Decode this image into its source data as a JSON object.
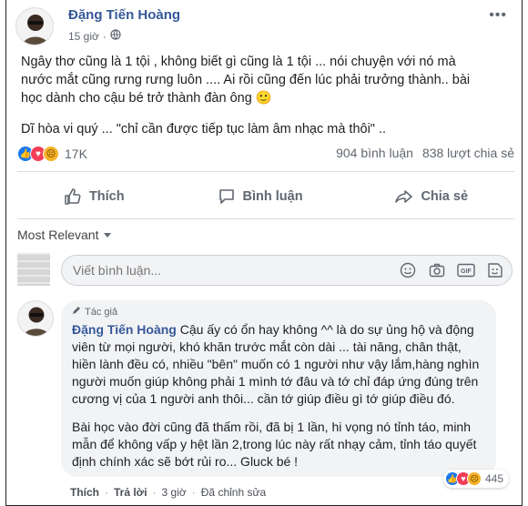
{
  "post": {
    "author": "Đặng Tiến Hoàng",
    "time": "15 giờ",
    "more": "•••",
    "paragraph1": "Ngây thơ cũng là 1 tội , không biết gì cũng là 1 tội ... nói chuyện với nó mà nước mắt cũng rưng rưng luôn .... Ai rồi cũng đến lúc phải trưởng thành.. bài học dành cho cậu bé trở thành đàn ông 🙂",
    "paragraph2": "Dĩ hòa vi quý ... \"chỉ cần được tiếp tục làm âm nhạc mà thôi\" .."
  },
  "stats": {
    "reaction_count": "17K",
    "comments": "904 bình luận",
    "shares": "838 lượt chia sẻ"
  },
  "actions": {
    "like": "Thích",
    "comment": "Bình luận",
    "share": "Chia sẻ"
  },
  "comments_section": {
    "sort_label": "Most Relevant",
    "input_placeholder": "Viết bình luận..."
  },
  "reply": {
    "badge": "Tác giả",
    "author": "Đặng Tiến Hoàng",
    "text1": "Cậu ấy có ổn hay không ^^ là do sự ủng hộ và động viên từ mọi người, khó khăn trước mắt còn dài ... tài năng, chân thật, hiền lành đều có, nhiều \"bên\" muốn có 1 người như vậy lắm,hàng nghìn người muốn giúp không phải 1 mình tớ đâu và tớ chỉ đáp ứng đúng trên cương vị của 1 người anh thôi... cần tớ giúp điều gì tớ giúp điều đó.",
    "text2": "Bài học vào đời cũng đã thấm rồi, đã bị 1 lần, hi vọng nó tỉnh táo, minh mẫn để không vấp y hệt lần 2,trong lúc này rất nhạy cảm, tỉnh táo quyết định chính xác sẽ bớt rủi ro... Gluck bé !",
    "reaction_count": "445",
    "like": "Thích",
    "reply_label": "Trả lời",
    "time": "3 giờ",
    "edited": "Đã chỉnh sửa"
  }
}
